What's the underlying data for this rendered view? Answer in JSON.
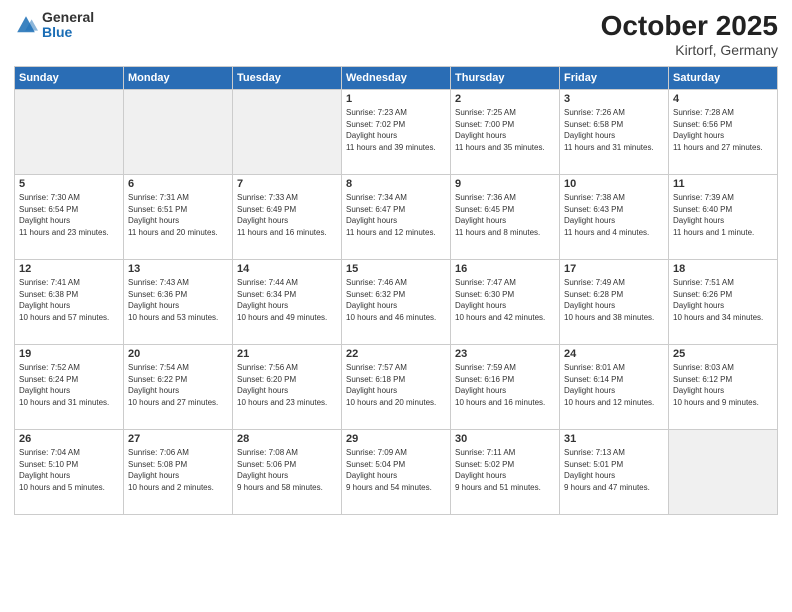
{
  "header": {
    "logo": {
      "general": "General",
      "blue": "Blue"
    },
    "month": "October 2025",
    "location": "Kirtorf, Germany"
  },
  "weekdays": [
    "Sunday",
    "Monday",
    "Tuesday",
    "Wednesday",
    "Thursday",
    "Friday",
    "Saturday"
  ],
  "weeks": [
    [
      {
        "day": "",
        "empty": true
      },
      {
        "day": "",
        "empty": true
      },
      {
        "day": "",
        "empty": true
      },
      {
        "day": "1",
        "sunrise": "7:23 AM",
        "sunset": "7:02 PM",
        "daylight": "11 hours and 39 minutes."
      },
      {
        "day": "2",
        "sunrise": "7:25 AM",
        "sunset": "7:00 PM",
        "daylight": "11 hours and 35 minutes."
      },
      {
        "day": "3",
        "sunrise": "7:26 AM",
        "sunset": "6:58 PM",
        "daylight": "11 hours and 31 minutes."
      },
      {
        "day": "4",
        "sunrise": "7:28 AM",
        "sunset": "6:56 PM",
        "daylight": "11 hours and 27 minutes."
      }
    ],
    [
      {
        "day": "5",
        "sunrise": "7:30 AM",
        "sunset": "6:54 PM",
        "daylight": "11 hours and 23 minutes."
      },
      {
        "day": "6",
        "sunrise": "7:31 AM",
        "sunset": "6:51 PM",
        "daylight": "11 hours and 20 minutes."
      },
      {
        "day": "7",
        "sunrise": "7:33 AM",
        "sunset": "6:49 PM",
        "daylight": "11 hours and 16 minutes."
      },
      {
        "day": "8",
        "sunrise": "7:34 AM",
        "sunset": "6:47 PM",
        "daylight": "11 hours and 12 minutes."
      },
      {
        "day": "9",
        "sunrise": "7:36 AM",
        "sunset": "6:45 PM",
        "daylight": "11 hours and 8 minutes."
      },
      {
        "day": "10",
        "sunrise": "7:38 AM",
        "sunset": "6:43 PM",
        "daylight": "11 hours and 4 minutes."
      },
      {
        "day": "11",
        "sunrise": "7:39 AM",
        "sunset": "6:40 PM",
        "daylight": "11 hours and 1 minute."
      }
    ],
    [
      {
        "day": "12",
        "sunrise": "7:41 AM",
        "sunset": "6:38 PM",
        "daylight": "10 hours and 57 minutes."
      },
      {
        "day": "13",
        "sunrise": "7:43 AM",
        "sunset": "6:36 PM",
        "daylight": "10 hours and 53 minutes."
      },
      {
        "day": "14",
        "sunrise": "7:44 AM",
        "sunset": "6:34 PM",
        "daylight": "10 hours and 49 minutes."
      },
      {
        "day": "15",
        "sunrise": "7:46 AM",
        "sunset": "6:32 PM",
        "daylight": "10 hours and 46 minutes."
      },
      {
        "day": "16",
        "sunrise": "7:47 AM",
        "sunset": "6:30 PM",
        "daylight": "10 hours and 42 minutes."
      },
      {
        "day": "17",
        "sunrise": "7:49 AM",
        "sunset": "6:28 PM",
        "daylight": "10 hours and 38 minutes."
      },
      {
        "day": "18",
        "sunrise": "7:51 AM",
        "sunset": "6:26 PM",
        "daylight": "10 hours and 34 minutes."
      }
    ],
    [
      {
        "day": "19",
        "sunrise": "7:52 AM",
        "sunset": "6:24 PM",
        "daylight": "10 hours and 31 minutes."
      },
      {
        "day": "20",
        "sunrise": "7:54 AM",
        "sunset": "6:22 PM",
        "daylight": "10 hours and 27 minutes."
      },
      {
        "day": "21",
        "sunrise": "7:56 AM",
        "sunset": "6:20 PM",
        "daylight": "10 hours and 23 minutes."
      },
      {
        "day": "22",
        "sunrise": "7:57 AM",
        "sunset": "6:18 PM",
        "daylight": "10 hours and 20 minutes."
      },
      {
        "day": "23",
        "sunrise": "7:59 AM",
        "sunset": "6:16 PM",
        "daylight": "10 hours and 16 minutes."
      },
      {
        "day": "24",
        "sunrise": "8:01 AM",
        "sunset": "6:14 PM",
        "daylight": "10 hours and 12 minutes."
      },
      {
        "day": "25",
        "sunrise": "8:03 AM",
        "sunset": "6:12 PM",
        "daylight": "10 hours and 9 minutes."
      }
    ],
    [
      {
        "day": "26",
        "sunrise": "7:04 AM",
        "sunset": "5:10 PM",
        "daylight": "10 hours and 5 minutes."
      },
      {
        "day": "27",
        "sunrise": "7:06 AM",
        "sunset": "5:08 PM",
        "daylight": "10 hours and 2 minutes."
      },
      {
        "day": "28",
        "sunrise": "7:08 AM",
        "sunset": "5:06 PM",
        "daylight": "9 hours and 58 minutes."
      },
      {
        "day": "29",
        "sunrise": "7:09 AM",
        "sunset": "5:04 PM",
        "daylight": "9 hours and 54 minutes."
      },
      {
        "day": "30",
        "sunrise": "7:11 AM",
        "sunset": "5:02 PM",
        "daylight": "9 hours and 51 minutes."
      },
      {
        "day": "31",
        "sunrise": "7:13 AM",
        "sunset": "5:01 PM",
        "daylight": "9 hours and 47 minutes."
      },
      {
        "day": "",
        "empty": true
      }
    ]
  ]
}
